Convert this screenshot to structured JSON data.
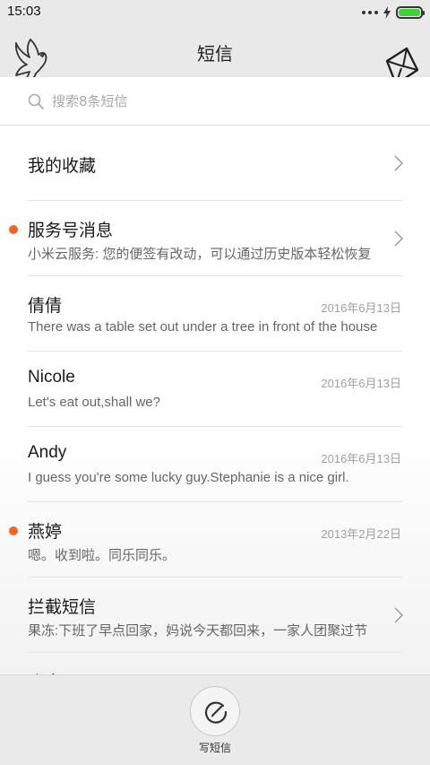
{
  "status_bar": {
    "time": "15:03"
  },
  "header": {
    "title": "短信"
  },
  "search": {
    "placeholder": "搜索8条短信"
  },
  "conversations": [
    {
      "title": "我的收藏",
      "subtitle": "",
      "date": "",
      "unread": false,
      "has_chevron": true
    },
    {
      "title": "服务号消息",
      "subtitle": "小米云服务: 您的便签有改动，可以通过历史版本轻松恢复",
      "date": "",
      "unread": true,
      "has_chevron": true
    },
    {
      "title": "倩倩",
      "subtitle": "There was a table set out under a tree in front of the house",
      "date": "2016年6月13日",
      "unread": false,
      "has_chevron": false
    },
    {
      "title": "Nicole",
      "subtitle": "Let's eat out,shall we?",
      "date": "2016年6月13日",
      "unread": false,
      "has_chevron": false
    },
    {
      "title": "Andy",
      "subtitle": "I guess you're some lucky guy.Stephanie is a nice girl.",
      "date": "2016年6月13日",
      "unread": false,
      "has_chevron": false
    },
    {
      "title": "燕婷",
      "subtitle": "嗯。收到啦。同乐同乐。",
      "date": "2013年2月22日",
      "unread": true,
      "has_chevron": false
    },
    {
      "title": "拦截短信",
      "subtitle": "果冻:下班了早点回家，妈说今天都回来，一家人团聚过节",
      "date": "",
      "unread": false,
      "has_chevron": true
    },
    {
      "title": "账户",
      "subtitle": "",
      "date": "",
      "unread": false,
      "has_chevron": false
    }
  ],
  "bottom_bar": {
    "compose_label": "写短信"
  },
  "colors": {
    "unread_dot": "#f26520",
    "battery": "#3fd13a",
    "header_bg": "#e9e9e9"
  },
  "icons": {
    "dove": "dove-icon",
    "envelope": "envelope-icon",
    "search": "search-icon",
    "chevron": "chevron-right-icon",
    "compose": "compose-icon"
  }
}
